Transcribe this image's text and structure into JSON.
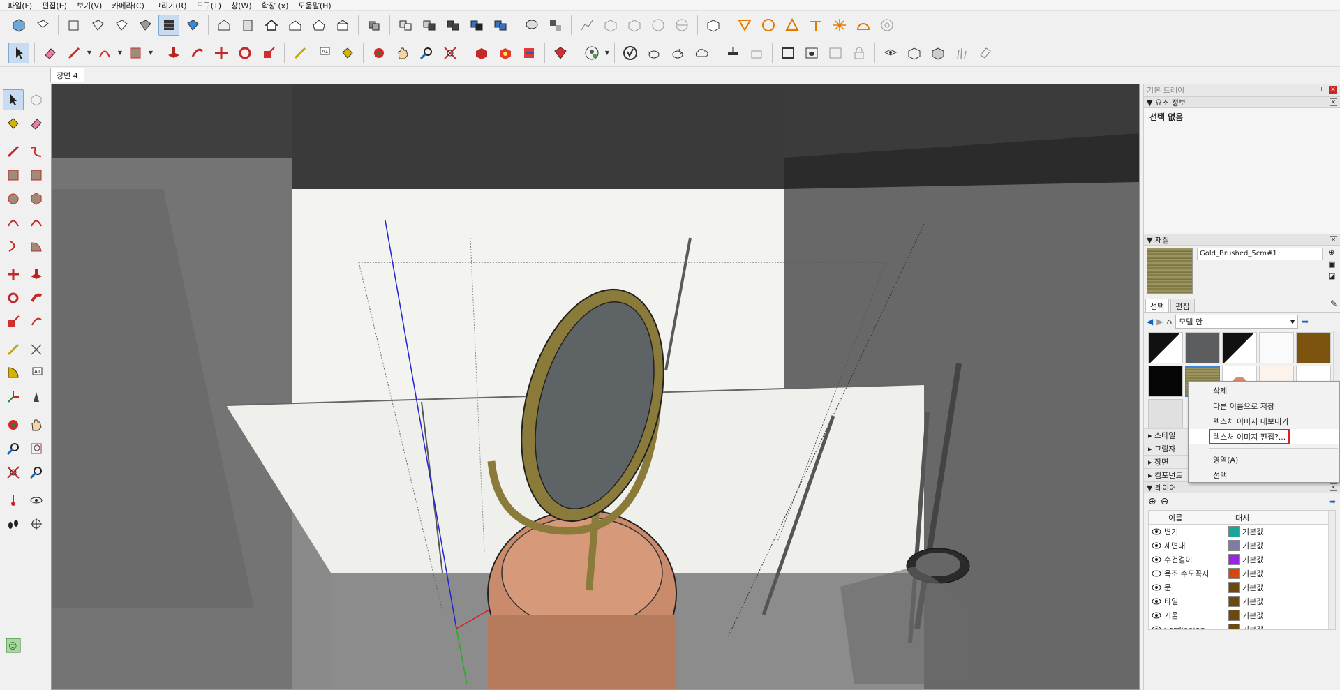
{
  "menu": [
    "파일(F)",
    "편집(E)",
    "보기(V)",
    "카메라(C)",
    "그리기(R)",
    "도구(T)",
    "창(W)",
    "확장 (x)",
    "도움말(H)"
  ],
  "scene_tab": "장면 4",
  "tray": {
    "title": "기본 트레이",
    "entity_info": {
      "header": "요소 정보",
      "body": "선택 없음"
    },
    "materials": {
      "header": "재질",
      "material_name": "Gold_Brushed_5cm#1",
      "tabs": [
        "선택",
        "편집"
      ],
      "collection": "모델 안"
    },
    "collapsed_panels": [
      "스타일",
      "그림자",
      "장면",
      "컴포넌트"
    ],
    "layers": {
      "header": "레이어",
      "col_name": "이름",
      "col_dash": "대시",
      "rows": [
        {
          "name": "변기",
          "color": "#1aa59a",
          "dash": "기본값",
          "visible": true
        },
        {
          "name": "세면대",
          "color": "#7f7aa6",
          "dash": "기본값",
          "visible": true
        },
        {
          "name": "수건걸이",
          "color": "#9b22e6",
          "dash": "기본값",
          "visible": true
        },
        {
          "name": "욕조 수도꼭지",
          "color": "#d6470f",
          "dash": "기본값",
          "visible": false
        },
        {
          "name": "문",
          "color": "#6b4a12",
          "dash": "기본값",
          "visible": true
        },
        {
          "name": "타일",
          "color": "#6b4a12",
          "dash": "기본값",
          "visible": true
        },
        {
          "name": "거울",
          "color": "#6b4a12",
          "dash": "기본값",
          "visible": true
        },
        {
          "name": "verdieping",
          "color": "#6b4a12",
          "dash": "기본값",
          "visible": true
        }
      ]
    }
  },
  "context_menu": {
    "items": [
      "삭제",
      "다른 이름으로 저장",
      "텍스처 이미지 내보내기",
      "텍스처 이미지 편집?...",
      "영역(A)",
      "선택"
    ]
  }
}
